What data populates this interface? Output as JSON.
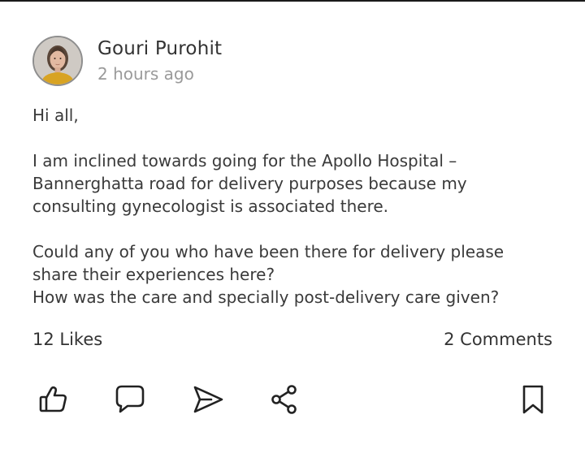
{
  "post": {
    "author": {
      "name": "Gouri Purohit",
      "avatar_icon": "user-avatar-photo"
    },
    "time": "2 hours ago",
    "greeting": "Hi all,",
    "paragraph_1": "I am inclined towards going for the Apollo Hospital –\nBannerghatta road for delivery purposes because my\nconsulting gynecologist is associated there.",
    "paragraph_2": "Could any of you who have been there for delivery please\nshare their experiences here?\nHow was the care and specially post-delivery care given?"
  },
  "stats": {
    "likes": "12 Likes",
    "comments": "2 Comments"
  },
  "actions": [
    {
      "name": "like",
      "icon": "thumbs-up-icon"
    },
    {
      "name": "comment",
      "icon": "speech-bubble-icon"
    },
    {
      "name": "send",
      "icon": "send-icon"
    },
    {
      "name": "share",
      "icon": "share-icon"
    },
    {
      "name": "bookmark",
      "icon": "bookmark-icon"
    }
  ],
  "colors": {
    "text": "#333333",
    "muted": "#9a9a9a",
    "icon": "#222222",
    "background": "#ffffff"
  }
}
